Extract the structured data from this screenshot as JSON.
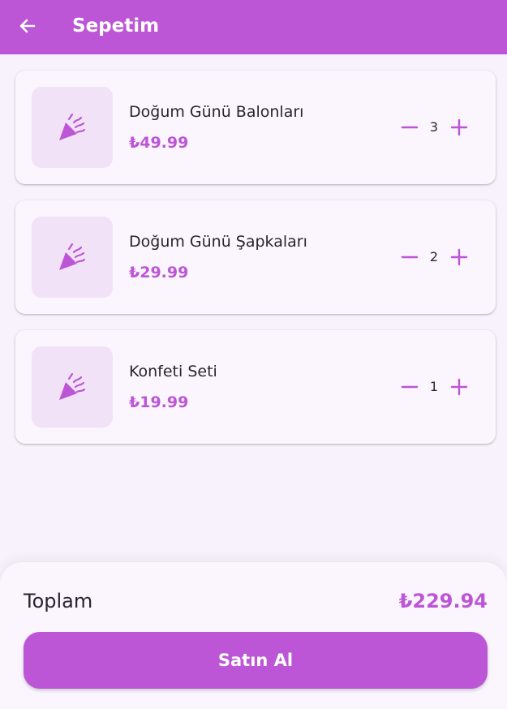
{
  "app_bar": {
    "title": "Sepetim",
    "back_icon": "arrow-back-icon",
    "background": "#bc55d6"
  },
  "cart": {
    "items": [
      {
        "name": "Doğum Günü Balonları",
        "price": "₺49.99",
        "quantity": "3",
        "icon": "party-popper-icon"
      },
      {
        "name": "Doğum Günü Şapkaları",
        "price": "₺29.99",
        "quantity": "2",
        "icon": "party-popper-icon"
      },
      {
        "name": "Konfeti Seti",
        "price": "₺19.99",
        "quantity": "1",
        "icon": "party-popper-icon"
      }
    ]
  },
  "summary": {
    "total_label": "Toplam",
    "total_value": "₺229.94",
    "checkout_label": "Satın Al"
  },
  "colors": {
    "accent": "#bc55d6",
    "background": "#f8f2fc",
    "thumb_background": "#f2e2f8"
  }
}
